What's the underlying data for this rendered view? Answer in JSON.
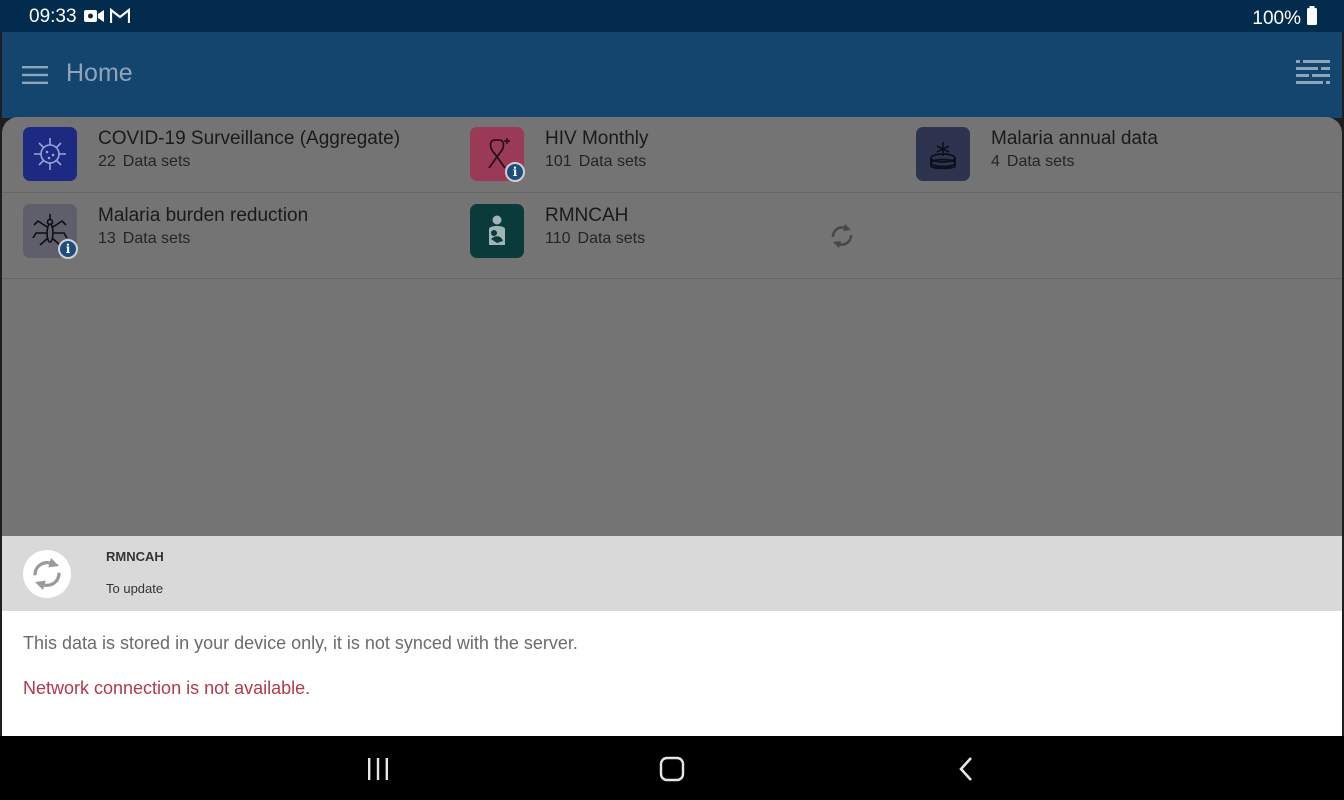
{
  "status_bar": {
    "time": "09:33",
    "battery": "100%",
    "icons": [
      "video-camera-icon",
      "gmail-icon",
      "battery-icon"
    ]
  },
  "app_bar": {
    "title": "Home",
    "icons": [
      "menu-icon",
      "filter-icon"
    ]
  },
  "programs": [
    {
      "name": "COVID-19 Surveillance (Aggregate)",
      "count": "22",
      "unit": "Data sets",
      "icon": "virus-icon",
      "color": "#1c2a82",
      "info": false
    },
    {
      "name": "HIV Monthly",
      "count": "101",
      "unit": "Data sets",
      "icon": "ribbon-icon",
      "color": "#9a3a56",
      "info": true
    },
    {
      "name": "Malaria annual data",
      "count": "4",
      "unit": "Data sets",
      "icon": "cake-icon",
      "color": "#2e3350",
      "info": false
    },
    {
      "name": "Malaria burden reduction",
      "count": "13",
      "unit": "Data sets",
      "icon": "mosquito-icon",
      "color": "#5e5f6a",
      "info": true
    },
    {
      "name": "RMNCAH",
      "count": "110",
      "unit": "Data sets",
      "icon": "mother-child-icon",
      "color": "#0a3a3a",
      "info": false
    }
  ],
  "sheet": {
    "title": "RMNCAH",
    "subtitle": "To update",
    "message": "This data is stored in your device only, it is not synced with the server.",
    "error": "Network connection is not available.",
    "error_color": "#b23a48"
  },
  "colors": {
    "status_bar": "#032b4d",
    "app_bar": "#14456e",
    "scrim_content": "#747474"
  }
}
